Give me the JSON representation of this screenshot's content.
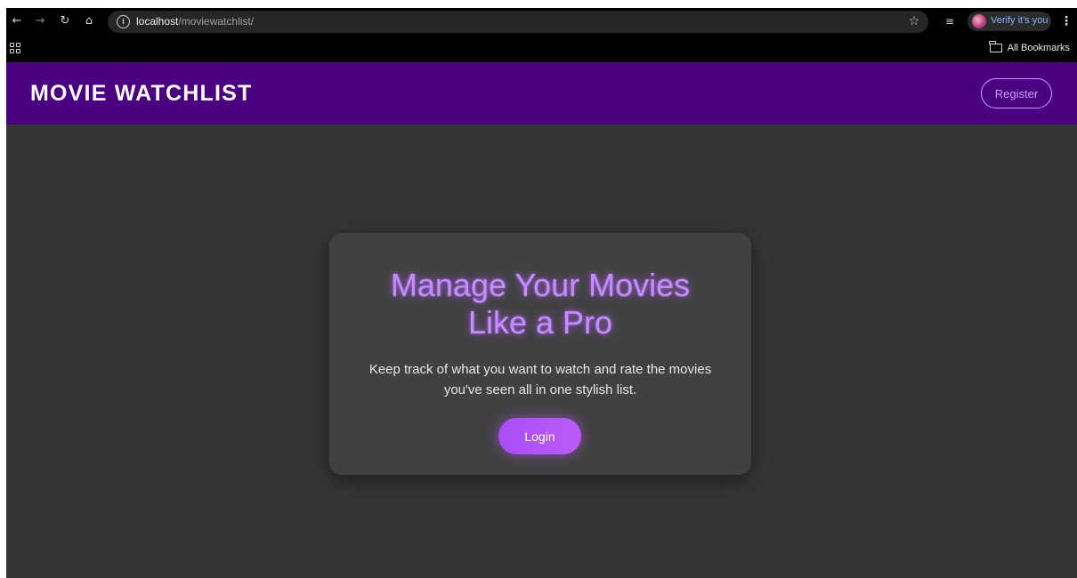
{
  "browser": {
    "url_host": "localhost",
    "url_path": "/moviewatchlist/",
    "profile_chip": "Verify it's you",
    "bookmarks_folder": "All Bookmarks",
    "icons": [
      "back-icon",
      "forward-icon",
      "reload-icon",
      "home-icon",
      "site-info-icon",
      "star-icon",
      "reading-list-icon",
      "menu-icon",
      "apps-icon",
      "folder-icon"
    ]
  },
  "header": {
    "title": "MOVIE WATCHLIST",
    "register_label": "Register"
  },
  "hero": {
    "title_line1": "Manage Your Movies",
    "title_line2": "Like a Pro",
    "subtitle_line1": "Keep track of what you want to watch and rate the movies",
    "subtitle_line2": "you've seen all in one stylish list.",
    "login_label": "Login"
  },
  "colors": {
    "header_bg": "#4b0082",
    "page_bg": "#353535",
    "card_bg": "#414141",
    "accent": "#c58cff",
    "button": "#b055f7"
  }
}
